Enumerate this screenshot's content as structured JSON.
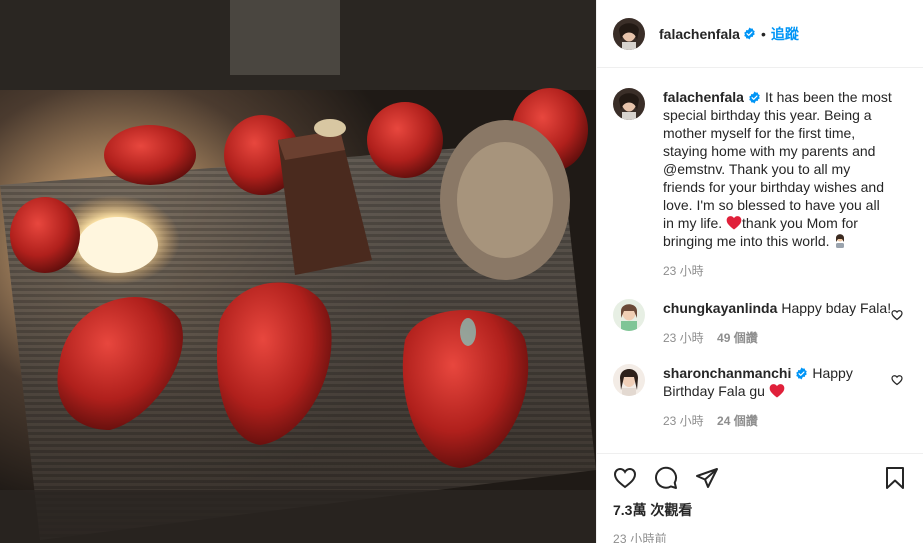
{
  "post": {
    "username": "falachenfala",
    "follow_label": "追蹤",
    "separator": "•"
  },
  "caption": {
    "username": "falachenfala",
    "text": "It has been the most special birthday this year. Being a mother myself for the first time, staying home with my parents and @emstnv. Thank you to all my friends for your birthday wishes and love. I'm so blessed to have you all in my life. ",
    "text2": "thank you Mom for bringing me into this world. ",
    "time": "23 小時"
  },
  "comments": [
    {
      "username": "chungkayanlinda",
      "text": "Happy bday Fala!",
      "time": "23 小時",
      "likes": "49 個讚"
    },
    {
      "username": "sharonchanmanchi",
      "text": "Happy Birthday Fala gu ",
      "time": "23 小時",
      "likes": "24 個讚"
    }
  ],
  "stats": {
    "views": "7.3萬 次觀看",
    "posted": "23 小時前"
  },
  "icons": {
    "verified": "verified-badge-icon",
    "like": "heart-outline-icon",
    "comment": "comment-bubble-icon",
    "share": "paper-plane-icon",
    "save": "bookmark-icon"
  },
  "colors": {
    "accent": "#0095f6",
    "muted": "#8e8e8e",
    "heart_red": "#e0203a"
  }
}
